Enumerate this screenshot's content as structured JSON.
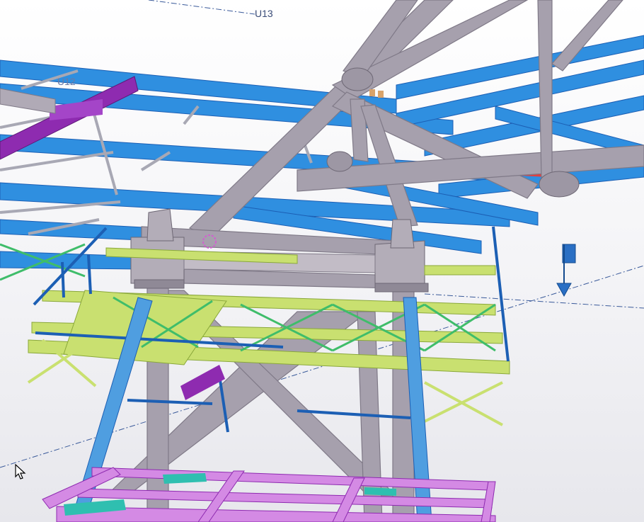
{
  "viewport": {
    "grid_labels": {
      "u13": "U13",
      "u12": "U12"
    }
  },
  "colors": {
    "background": "#f3f3f6",
    "blue_beam": "#2f8fe0",
    "blue_beam_dark": "#1c5fb4",
    "gray_tube": "#a6a0ad",
    "gray_tube_dark": "#7f7987",
    "yellow_green": "#c9e070",
    "green": "#3fbd6a",
    "magenta": "#8e2bb0",
    "pink": "#d48ae4",
    "teal": "#2fbfb0",
    "red": "#e04040",
    "gridline": "#3a5a9a"
  },
  "icons": {
    "cursor": "mouse-pointer-icon",
    "view_marker": "blue-flag-arrow-icon"
  }
}
